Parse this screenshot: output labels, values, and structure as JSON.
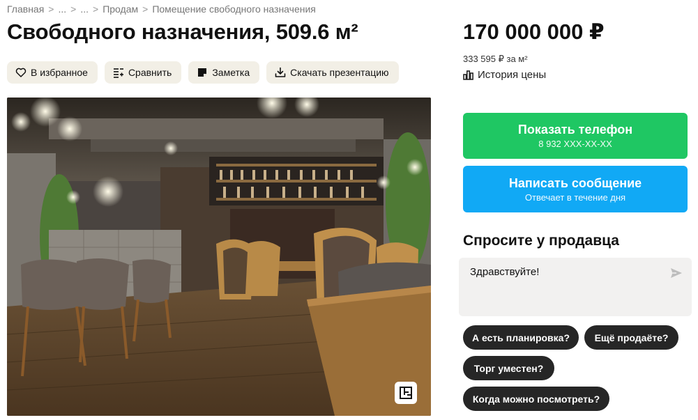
{
  "breadcrumb": [
    "Главная",
    "...",
    "...",
    "Продам",
    "Помещение свободного назначения"
  ],
  "breadcrumb_separator": ">",
  "title": "Свободного назначения, 509.6 м²",
  "actions": {
    "favorite": "В избранное",
    "compare": "Сравнить",
    "note": "Заметка",
    "download": "Скачать презентацию"
  },
  "price": "170 000 000 ₽",
  "price_per_m": "333 595 ₽ за м²",
  "price_history": "История цены",
  "phone_button": {
    "label": "Показать телефон",
    "sub": "8 932 XXX-XX-XX"
  },
  "message_button": {
    "label": "Написать сообщение",
    "sub": "Отвечает в течение дня"
  },
  "ask_seller": {
    "title": "Спросите у продавца",
    "message": "Здравствуйте!",
    "quick_questions": [
      "А есть планировка?",
      "Ещё продаёте?",
      "Торг уместен?",
      "Когда можно посмотреть?"
    ]
  },
  "colors": {
    "green": "#1fc763",
    "blue": "#11a9f5",
    "chip": "#262626",
    "action_bg": "#f2efe6"
  },
  "icons": [
    "heart-icon",
    "compare-icon",
    "note-icon",
    "download-icon",
    "chart-icon",
    "send-icon",
    "floorplan-icon"
  ]
}
